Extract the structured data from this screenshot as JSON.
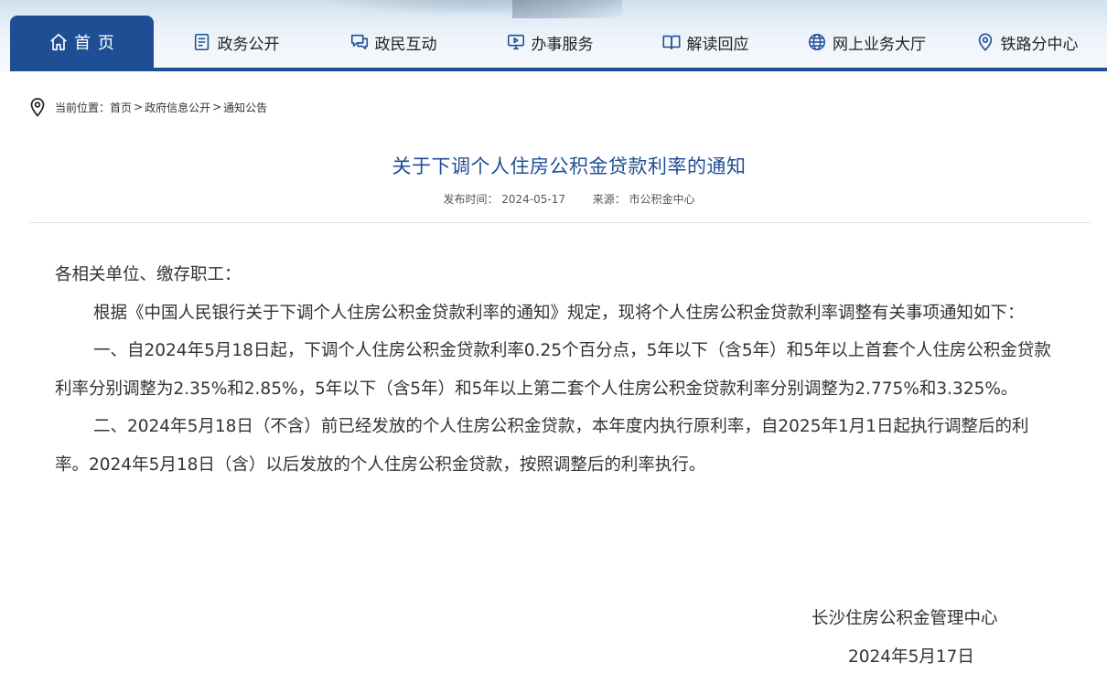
{
  "nav": {
    "items": [
      {
        "label": "首 页",
        "icon": "home-icon",
        "active": true
      },
      {
        "label": "政务公开",
        "icon": "document-icon",
        "active": false
      },
      {
        "label": "政民互动",
        "icon": "chat-icon",
        "active": false
      },
      {
        "label": "办事服务",
        "icon": "monitor-icon",
        "active": false
      },
      {
        "label": "解读回应",
        "icon": "book-icon",
        "active": false
      },
      {
        "label": "网上业务大厅",
        "icon": "globe-icon",
        "active": false
      },
      {
        "label": "铁路分中心",
        "icon": "location-icon",
        "active": false
      }
    ],
    "accent_color": "#1f4e94"
  },
  "breadcrumb": {
    "prefix": "当前位置：",
    "items": [
      "首页",
      "政府信息公开",
      "通知公告"
    ],
    "separator": ">"
  },
  "article": {
    "title": "关于下调个人住房公积金贷款利率的通知",
    "publish_label": "发布时间：",
    "publish_date": "2024-05-17",
    "source_label": "来源：",
    "source": "市公积金中心",
    "salutation": "各相关单位、缴存职工：",
    "paragraphs": [
      "根据《中国人民银行关于下调个人住房公积金贷款利率的通知》规定，现将个人住房公积金贷款利率调整有关事项通知如下：",
      "一、自2024年5月18日起，下调个人住房公积金贷款利率0.25个百分点，5年以下（含5年）和5年以上首套个人住房公积金贷款利率分别调整为2.35%和2.85%，5年以下（含5年）和5年以上第二套个人住房公积金贷款利率分别调整为2.775%和3.325%。",
      "二、2024年5月18日（不含）前已经发放的个人住房公积金贷款，本年度内执行原利率，自2025年1月1日起执行调整后的利率。2024年5月18日（含）以后发放的个人住房公积金贷款，按照调整后的利率执行。"
    ],
    "signature": "长沙住房公积金管理中心",
    "sign_date": "2024年5月17日"
  }
}
